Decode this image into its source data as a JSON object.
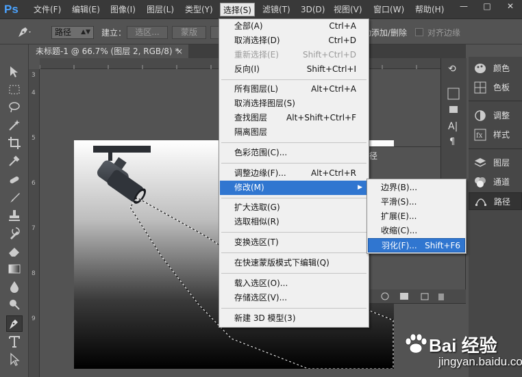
{
  "app_logo": "Ps",
  "menu_bar": {
    "items": [
      "文件(F)",
      "编辑(E)",
      "图像(I)",
      "图层(L)",
      "类型(Y)",
      "选择(S)",
      "滤镜(T)",
      "3D(D)",
      "视图(V)",
      "窗口(W)",
      "帮助(H)"
    ],
    "active_index": 5,
    "window_controls": [
      "—",
      "□",
      "✕"
    ]
  },
  "options_bar": {
    "mode_select": "路径",
    "build_label": "建立：",
    "selection_button": "选区...",
    "mask_button": "蒙版",
    "auto_add_delete": "自动添加/删除",
    "align_edges": "对齐边缘"
  },
  "document_tab": {
    "title": "未标题-1 @ 66.7% (图层 2, RGB/8) *",
    "close": "×"
  },
  "rulers": {
    "left": [
      "3",
      "4",
      "5",
      "6",
      "7",
      "8",
      "9"
    ]
  },
  "background_panel": {
    "tab_label": "径"
  },
  "select_menu": {
    "items": [
      {
        "label": "全部(A)",
        "shortcut": "Ctrl+A"
      },
      {
        "label": "取消选择(D)",
        "shortcut": "Ctrl+D"
      },
      {
        "label": "重新选择(E)",
        "shortcut": "Shift+Ctrl+D",
        "disabled": true
      },
      {
        "label": "反向(I)",
        "shortcut": "Shift+Ctrl+I"
      },
      {
        "label": "所有图层(L)",
        "shortcut": "Alt+Ctrl+A"
      },
      {
        "label": "取消选择图层(S)",
        "shortcut": ""
      },
      {
        "label": "查找图层",
        "shortcut": "Alt+Shift+Ctrl+F"
      },
      {
        "label": "隔离图层",
        "shortcut": ""
      },
      {
        "label": "色彩范围(C)...",
        "shortcut": ""
      },
      {
        "label": "调整边缘(F)...",
        "shortcut": "Alt+Ctrl+R"
      },
      {
        "label": "修改(M)",
        "shortcut": "",
        "highlighted": true,
        "submenu_arrow": "▶"
      },
      {
        "label": "扩大选取(G)",
        "shortcut": ""
      },
      {
        "label": "选取相似(R)",
        "shortcut": ""
      },
      {
        "label": "变换选区(T)",
        "shortcut": ""
      },
      {
        "label": "在快速蒙版模式下编辑(Q)",
        "shortcut": ""
      },
      {
        "label": "载入选区(O)...",
        "shortcut": ""
      },
      {
        "label": "存储选区(V)...",
        "shortcut": ""
      },
      {
        "label": "新建 3D 模型(3)",
        "shortcut": ""
      }
    ]
  },
  "modify_submenu": {
    "items": [
      {
        "label": "边界(B)...",
        "shortcut": ""
      },
      {
        "label": "平滑(S)...",
        "shortcut": ""
      },
      {
        "label": "扩展(E)...",
        "shortcut": ""
      },
      {
        "label": "收缩(C)...",
        "shortcut": ""
      },
      {
        "label": "羽化(F)...",
        "shortcut": "Shift+F6",
        "highlighted": true
      }
    ]
  },
  "right_dock": {
    "items": [
      "颜色",
      "色板",
      "调整",
      "样式",
      "图层",
      "通道",
      "路径"
    ],
    "active": "路径"
  },
  "watermark": {
    "brand": "Bai 经验",
    "domain": "jingyan.baidu.com"
  },
  "colors": {
    "menu_highlight": "#3076d0",
    "ps_blue": "#4ba3ff"
  }
}
